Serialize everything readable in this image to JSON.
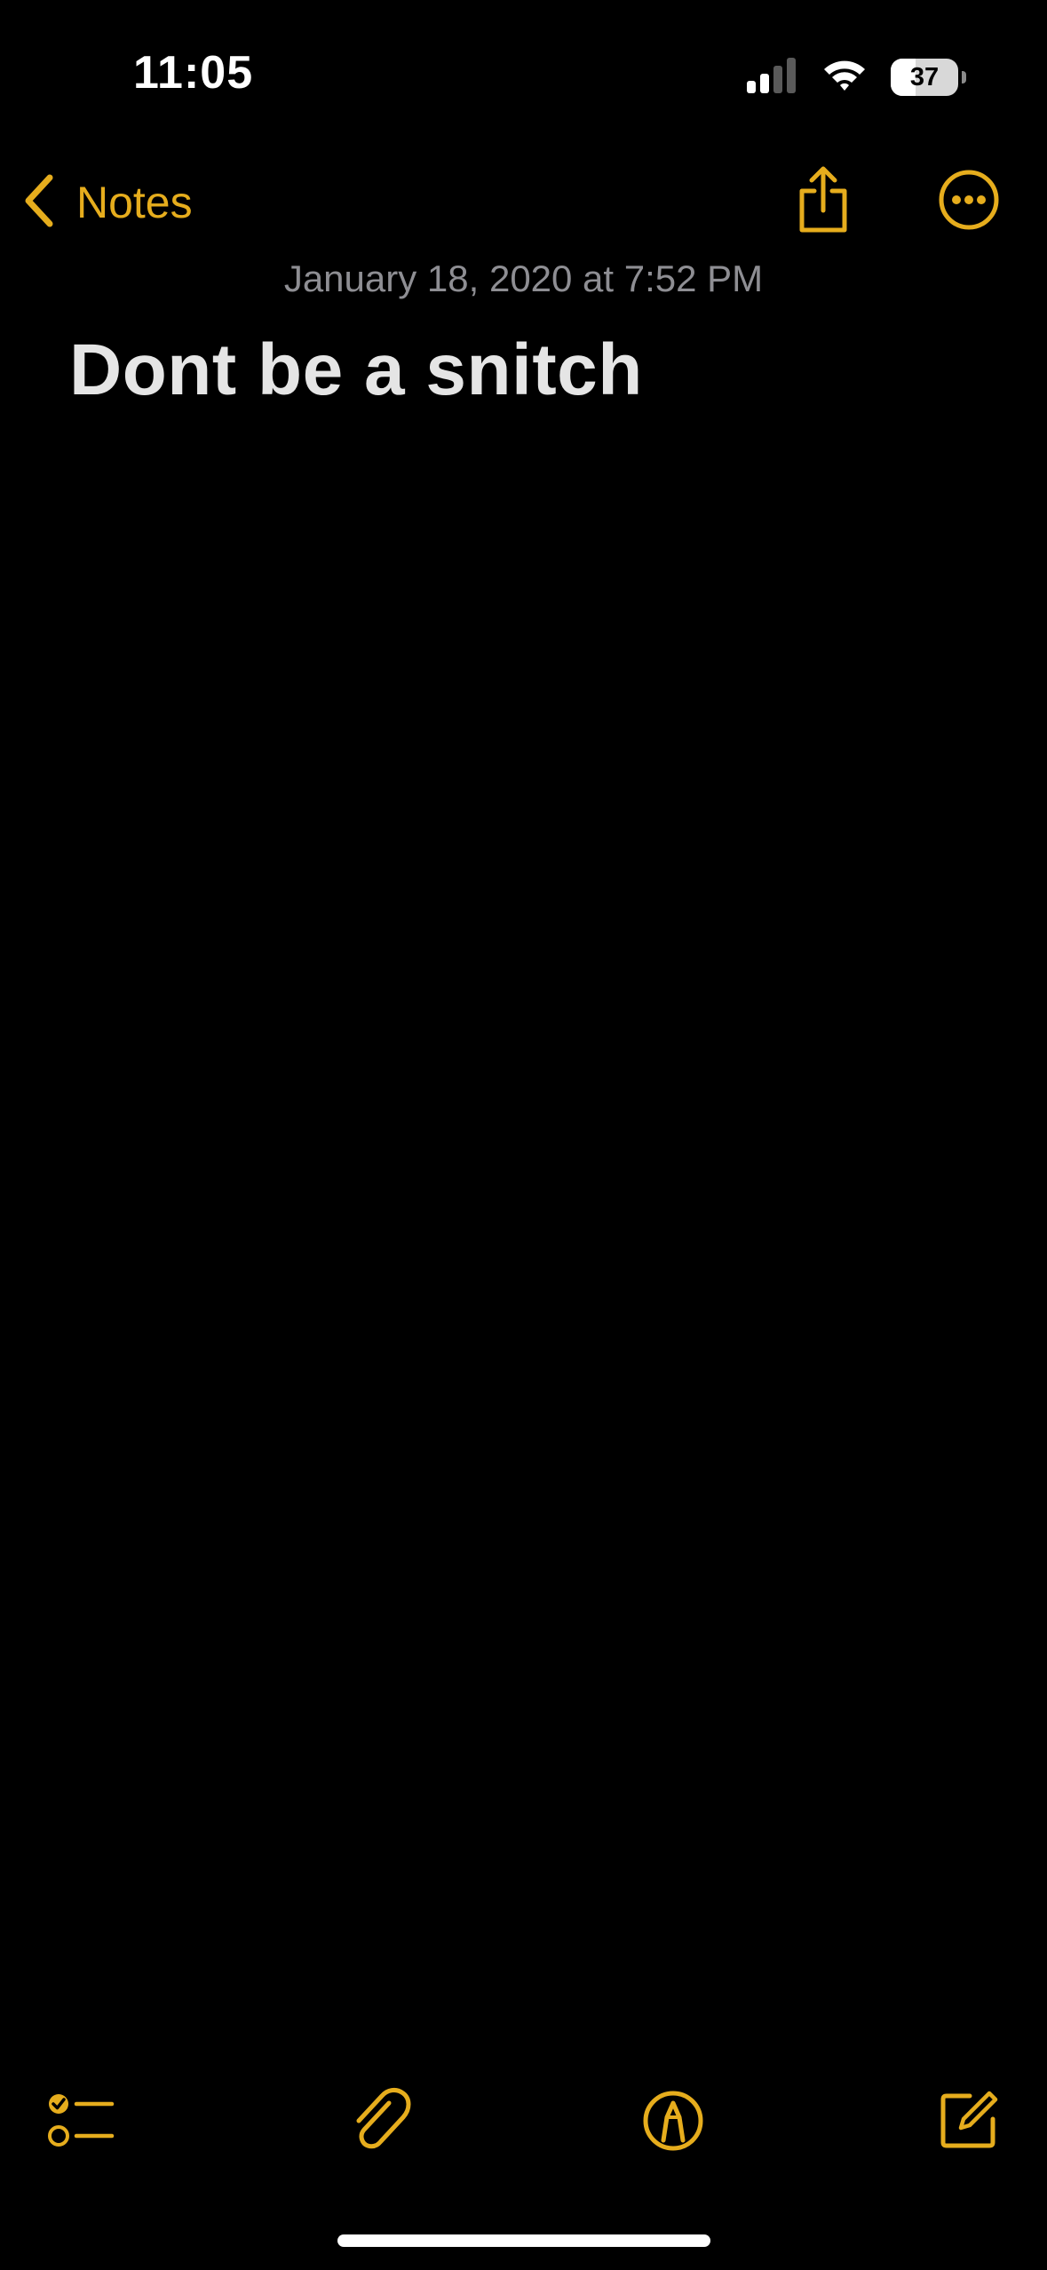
{
  "status_bar": {
    "time": "11:05",
    "battery_level": "37",
    "battery_fraction": 0.37,
    "signal_bars_active": 2,
    "signal_bars_total": 4
  },
  "nav": {
    "back_label": "Notes",
    "back_icon": "chevron-left-icon",
    "share_icon": "share-icon",
    "more_icon": "ellipsis-circle-icon"
  },
  "note": {
    "date": "January 18, 2020 at 7:52 PM",
    "title": "Dont be a snitch",
    "body": ""
  },
  "toolbar": {
    "items": [
      {
        "icon": "checklist-icon"
      },
      {
        "icon": "paperclip-icon"
      },
      {
        "icon": "markup-pen-icon"
      },
      {
        "icon": "compose-icon"
      }
    ]
  },
  "colors": {
    "accent": "#e6ad1d",
    "background": "#000000",
    "title_text": "#e5e5e5",
    "secondary_text": "#8e8e93"
  }
}
